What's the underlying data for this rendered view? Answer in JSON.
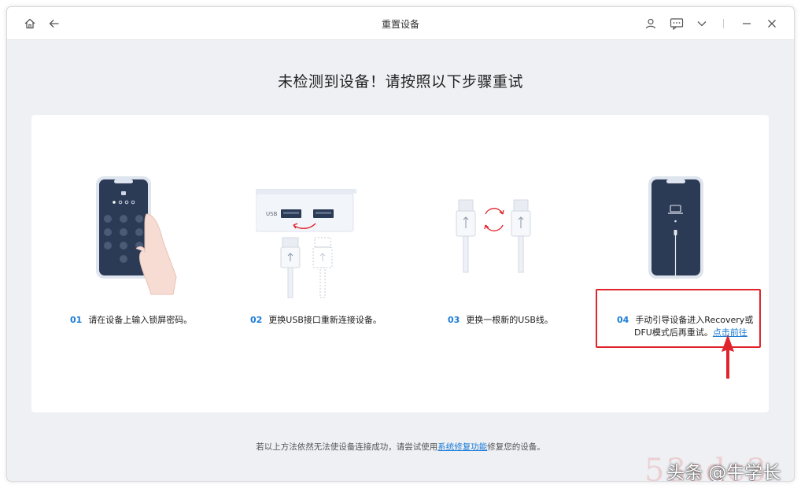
{
  "titlebar": {
    "title": "重置设备",
    "icons": [
      "home-icon",
      "back-arrow-icon",
      "user-icon",
      "chat-icon",
      "chevron-down-icon",
      "minimize-icon",
      "close-icon"
    ]
  },
  "heading": "未检测到设备！请按照以下步骤重试",
  "steps": [
    {
      "num": "01",
      "text": "请在设备上输入锁屏密码。",
      "icon": "phone-passcode-illustration"
    },
    {
      "num": "02",
      "text": "更换USB接口重新连接设备。",
      "icon": "usb-port-illustration"
    },
    {
      "num": "03",
      "text": "更换一根新的USB线。",
      "icon": "usb-cable-illustration"
    },
    {
      "num": "04",
      "text_line1": "手动引导设备进入Recovery或",
      "text_line2": "DFU模式后再重试。",
      "link": "点击前往",
      "icon": "recovery-mode-illustration"
    }
  ],
  "usb_label": "USB",
  "footer": {
    "before": "若以上方法依然无法使设备连接成功，请尝试使用",
    "link": "系统修复功能",
    "after": "修复您的设备。"
  },
  "watermark": {
    "text": "头条 @牛学长",
    "bg_text": "53sdc3"
  },
  "colors": {
    "accent": "#1c7cd6",
    "highlight": "#e0242b",
    "phone_screen": "#2b3a55",
    "background": "#eef0f4"
  }
}
